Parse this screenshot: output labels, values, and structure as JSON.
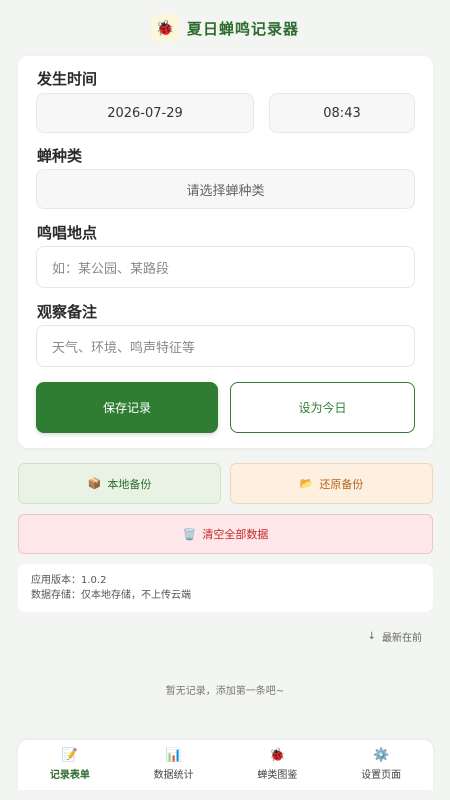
{
  "header": {
    "logo_icon": "🐞",
    "title": "夏日蝉鸣记录器"
  },
  "form": {
    "time_label": "发生时间",
    "date_value": "2026-07-29",
    "time_value": "08:43",
    "species_label": "蝉种类",
    "species_placeholder": "请选择蝉种类",
    "location_label": "鸣唱地点",
    "location_placeholder": "如：某公园、某路段",
    "notes_label": "观察备注",
    "notes_placeholder": "天气、环境、鸣声特征等",
    "save_label": "保存记录",
    "today_label": "设为今日"
  },
  "actions": {
    "backup_icon": "📦",
    "backup_label": "本地备份",
    "restore_icon": "📂",
    "restore_label": "还原备份",
    "clear_icon": "🗑️",
    "clear_label": "清空全部数据"
  },
  "info": {
    "version": "应用版本：1.0.2",
    "storage": "数据存储：仅本地存储，不上传云端"
  },
  "list": {
    "sort_arrow": "↓",
    "sort_label": "最新在前",
    "empty_text": "暂无记录，添加第一条吧~"
  },
  "tabs": [
    {
      "icon": "📝",
      "label": "记录表单"
    },
    {
      "icon": "📊",
      "label": "数据统计"
    },
    {
      "icon": "🐞",
      "label": "蝉类图鉴"
    },
    {
      "icon": "⚙️",
      "label": "设置页面"
    }
  ],
  "colors": {
    "primary": "#2f7d32",
    "danger": "#c62828",
    "warning": "#b5651d"
  }
}
